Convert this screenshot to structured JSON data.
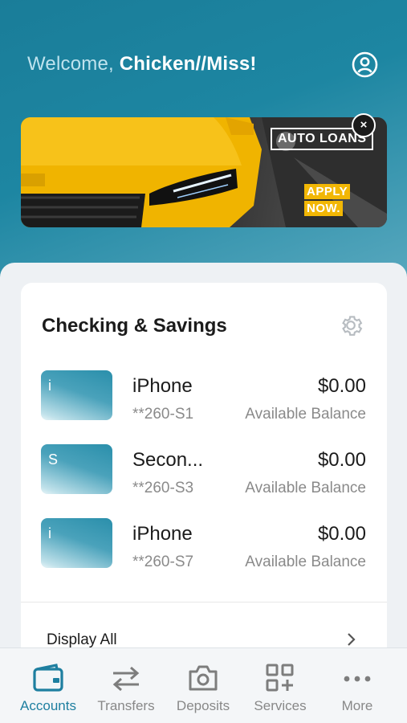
{
  "header": {
    "welcome_prefix": "Welcome, ",
    "user_name": "Chicken//Miss!",
    "profile_icon": "user-circle-icon"
  },
  "banner": {
    "tag": "AUTO LOANS",
    "cta_line1": "APPLY",
    "cta_line2": "NOW.",
    "close_label": "×"
  },
  "accounts_card": {
    "title": "Checking & Savings",
    "settings_icon": "gear-icon",
    "accounts": [
      {
        "initial": "i",
        "name": "iPhone",
        "number": "**260-S1",
        "amount": "$0.00",
        "balance_label": "Available Balance"
      },
      {
        "initial": "S",
        "name": "Secon...",
        "number": "**260-S3",
        "amount": "$0.00",
        "balance_label": "Available Balance"
      },
      {
        "initial": "i",
        "name": "iPhone",
        "number": "**260-S7",
        "amount": "$0.00",
        "balance_label": "Available Balance"
      }
    ],
    "display_all": "Display All"
  },
  "tabbar": {
    "tabs": [
      {
        "label": "Accounts",
        "icon": "wallet-icon",
        "active": true
      },
      {
        "label": "Transfers",
        "icon": "transfer-arrows-icon",
        "active": false
      },
      {
        "label": "Deposits",
        "icon": "camera-icon",
        "active": false
      },
      {
        "label": "Services",
        "icon": "grid-plus-icon",
        "active": false
      },
      {
        "label": "More",
        "icon": "more-dots-icon",
        "active": false
      }
    ]
  },
  "colors": {
    "brand": "#1e7fa0",
    "banner_accent": "#f2b705"
  }
}
